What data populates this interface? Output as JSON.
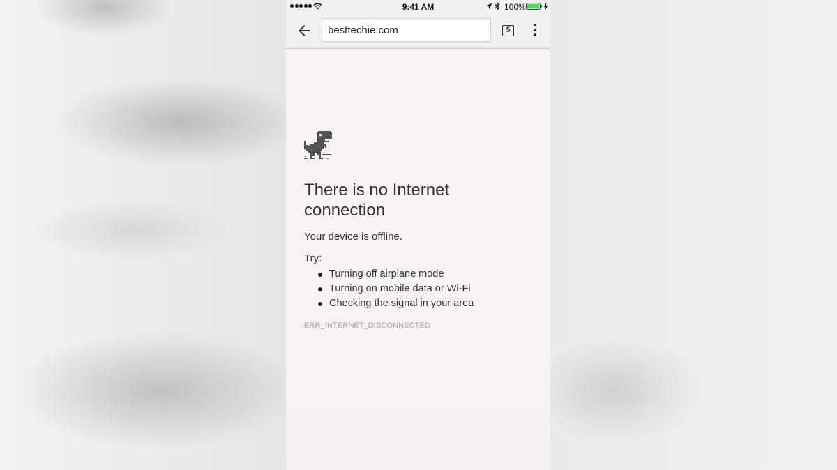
{
  "status_bar": {
    "signal_dots": 5,
    "time": "9:41 AM",
    "battery_percent": "100%",
    "battery_level": 1.0,
    "battery_color": "#4cd964",
    "icons": [
      "signal-dots-icon",
      "wifi-icon",
      "location-arrow-icon",
      "bluetooth-icon",
      "battery-icon",
      "charging-bolt-icon"
    ]
  },
  "toolbar": {
    "back_icon": "back-arrow-icon",
    "url": "besttechie.com",
    "tab_count": "5",
    "menu_icon": "overflow-menu-icon"
  },
  "error_page": {
    "icon": "offline-dinosaur-icon",
    "heading": "There is no Internet connection",
    "message": "Your device is offline.",
    "try_label": "Try:",
    "suggestions": [
      "Turning off airplane mode",
      "Turning on mobile data or Wi-Fi",
      "Checking the signal in your area"
    ],
    "error_code": "ERR_INTERNET_DISCONNECTED"
  },
  "colors": {
    "page_background": "#f6f2f5",
    "toolbar_background": "#f1f1f1",
    "text": "#333333",
    "error_code_text": "#a3a3a3"
  }
}
